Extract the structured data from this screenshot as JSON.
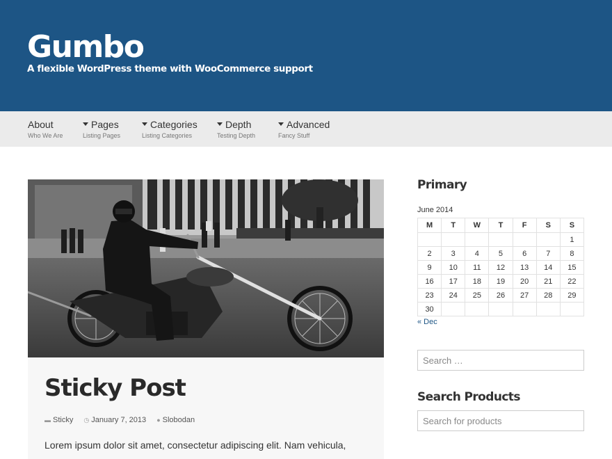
{
  "site": {
    "title": "Gumbo",
    "description": "A flexible WordPress theme with WooCommerce support"
  },
  "nav": {
    "items": [
      {
        "label": "About",
        "sub": "Who We Are"
      },
      {
        "label": "Pages",
        "sub": "Listing Pages"
      },
      {
        "label": "Categories",
        "sub": "Listing Categories"
      },
      {
        "label": "Depth",
        "sub": "Testing Depth"
      },
      {
        "label": "Advanced",
        "sub": "Fancy Stuff"
      }
    ]
  },
  "post": {
    "title": "Sticky Post",
    "category": "Sticky",
    "date": "January 7, 2013",
    "author": "Slobodan",
    "excerpt": "Lorem ipsum dolor sit amet, consectetur adipiscing elit. Nam vehicula,"
  },
  "sidebar": {
    "primary_title": "Primary",
    "calendar": {
      "caption": "June 2014",
      "days": [
        "M",
        "T",
        "W",
        "T",
        "F",
        "S",
        "S"
      ],
      "weeks": [
        [
          "",
          "",
          "",
          "",
          "",
          "",
          "1"
        ],
        [
          "2",
          "3",
          "4",
          "5",
          "6",
          "7",
          "8"
        ],
        [
          "9",
          "10",
          "11",
          "12",
          "13",
          "14",
          "15"
        ],
        [
          "16",
          "17",
          "18",
          "19",
          "20",
          "21",
          "22"
        ],
        [
          "23",
          "24",
          "25",
          "26",
          "27",
          "28",
          "29"
        ],
        [
          "30",
          "",
          "",
          "",
          "",
          "",
          ""
        ]
      ],
      "prev_label": "« Dec"
    },
    "search": {
      "placeholder": "Search …"
    },
    "products_title": "Search Products",
    "product_search": {
      "placeholder": "Search for products"
    }
  },
  "colors": {
    "header_bg": "#1d5585",
    "nav_bg": "#ebebeb",
    "link": "#1d5585"
  }
}
